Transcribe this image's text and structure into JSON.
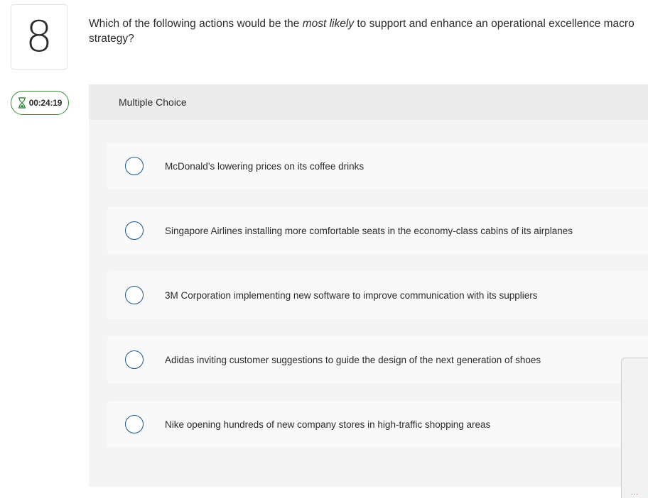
{
  "question": {
    "number": "8",
    "text_before": "Which of the following actions would be the ",
    "text_emphasis": "most likely",
    "text_after": " to support and enhance an operational excellence macro",
    "text_line2": "strategy?"
  },
  "timer": {
    "value": "00:24:19",
    "icon": "hourglass-icon",
    "color": "#3a8a3e"
  },
  "panel": {
    "header": "Multiple Choice"
  },
  "choices": [
    {
      "label": "McDonald’s lowering prices on its coffee drinks"
    },
    {
      "label": "Singapore Airlines installing more comfortable seats in the economy-class cabins of its airplanes"
    },
    {
      "label": "3M Corporation implementing new software to improve communication with its suppliers"
    },
    {
      "label": "Adidas inviting customer suggestions to guide the design of the next generation of shoes"
    },
    {
      "label": "Nike opening hundreds of new company stores in high-traffic shopping areas"
    }
  ],
  "side_widget": {
    "dots": "..."
  },
  "colors": {
    "radio_border": "#1a5694",
    "panel_bg": "#f4f4f4",
    "panel_header_bg": "#ececec"
  }
}
